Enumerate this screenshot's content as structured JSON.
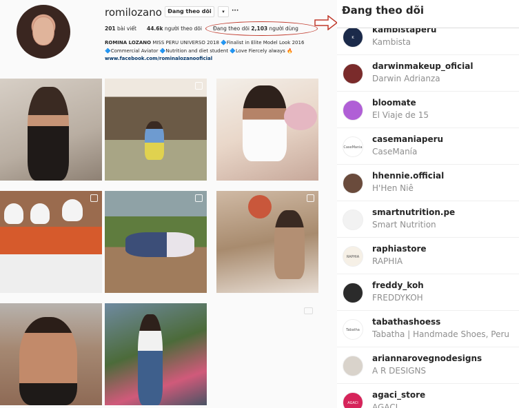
{
  "profile": {
    "username": "romilozano",
    "follow_button": "Đang theo dõi",
    "dropdown_icon": "▾",
    "more_icon": "···",
    "stats": {
      "posts_count": "201",
      "posts_label": "bài viết",
      "followers_count": "44.6k",
      "followers_label": "người theo dõi",
      "following_prefix": "Đang theo dõi",
      "following_count": "2,103",
      "following_suffix": "người dùng"
    },
    "bio": {
      "name": "ROMINA LOZANO",
      "line1_rest": "MISS PERU UNIVERSO 2018 🔷Finalist in Elite Model Look 2016",
      "line2": "🔷Commercial Aviator 🔷Nutrition and diet student 🔷Love Fiercely always 🔥",
      "link": "www.facebook.com/rominalozanooficial"
    },
    "highlight_color": "#c0392b"
  },
  "panel": {
    "title": "Đang theo dõi",
    "items": [
      {
        "username": "kambistaperu",
        "full_name": "Kambista",
        "avatar_label": "K",
        "avatar_color": "#1b2a4a"
      },
      {
        "username": "darwinmakeup_oficial",
        "full_name": "Darwin Adrianza",
        "avatar_label": "",
        "avatar_color": "#7a2b2b"
      },
      {
        "username": "bloomate",
        "full_name": "El Viaje de 15",
        "avatar_label": "",
        "avatar_color": "#b05fd6"
      },
      {
        "username": "casemaniaperu",
        "full_name": "CaseManía",
        "avatar_label": "CaseMania",
        "avatar_color": "#ffffff"
      },
      {
        "username": "hhennie.official",
        "full_name": "H'Hen Niê",
        "avatar_label": "",
        "avatar_color": "#6a4b3c"
      },
      {
        "username": "smartnutrition.pe",
        "full_name": "Smart Nutrition",
        "avatar_label": "",
        "avatar_color": "#f2f2f2"
      },
      {
        "username": "raphiastore",
        "full_name": "RAPHIA",
        "avatar_label": "RAPHIA",
        "avatar_color": "#f6f0e6"
      },
      {
        "username": "freddy_koh",
        "full_name": "FREDDYKOH",
        "avatar_label": "",
        "avatar_color": "#2b2b2b"
      },
      {
        "username": "tabathashoess",
        "full_name": "Tabatha | Handmade Shoes, Peru",
        "avatar_label": "Tabatha",
        "avatar_color": "#ffffff"
      },
      {
        "username": "ariannarovegnodesigns",
        "full_name": "A R DESIGNS",
        "avatar_label": "",
        "avatar_color": "#d9d3cb"
      },
      {
        "username": "agaci_store",
        "full_name": "AGACI",
        "avatar_label": "AGACI",
        "avatar_color": "#d6245a"
      }
    ]
  }
}
